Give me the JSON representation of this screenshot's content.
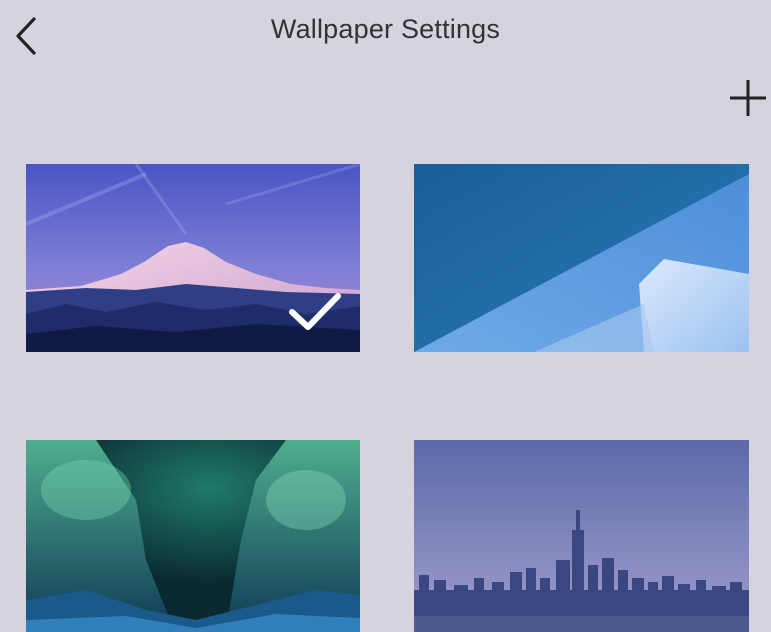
{
  "header": {
    "title": "Wallpaper Settings",
    "back_icon": "chevron-left-icon",
    "add_icon": "plus-icon"
  },
  "wallpapers": [
    {
      "subject": "mountain at dusk",
      "selected": true
    },
    {
      "subject": "blue abstract geometry",
      "selected": false
    },
    {
      "subject": "aurora in canyon",
      "selected": false
    },
    {
      "subject": "city skyline at dusk",
      "selected": false
    }
  ],
  "colors": {
    "background": "#d6d2de",
    "title_text": "#333333",
    "check": "#ffffff"
  }
}
